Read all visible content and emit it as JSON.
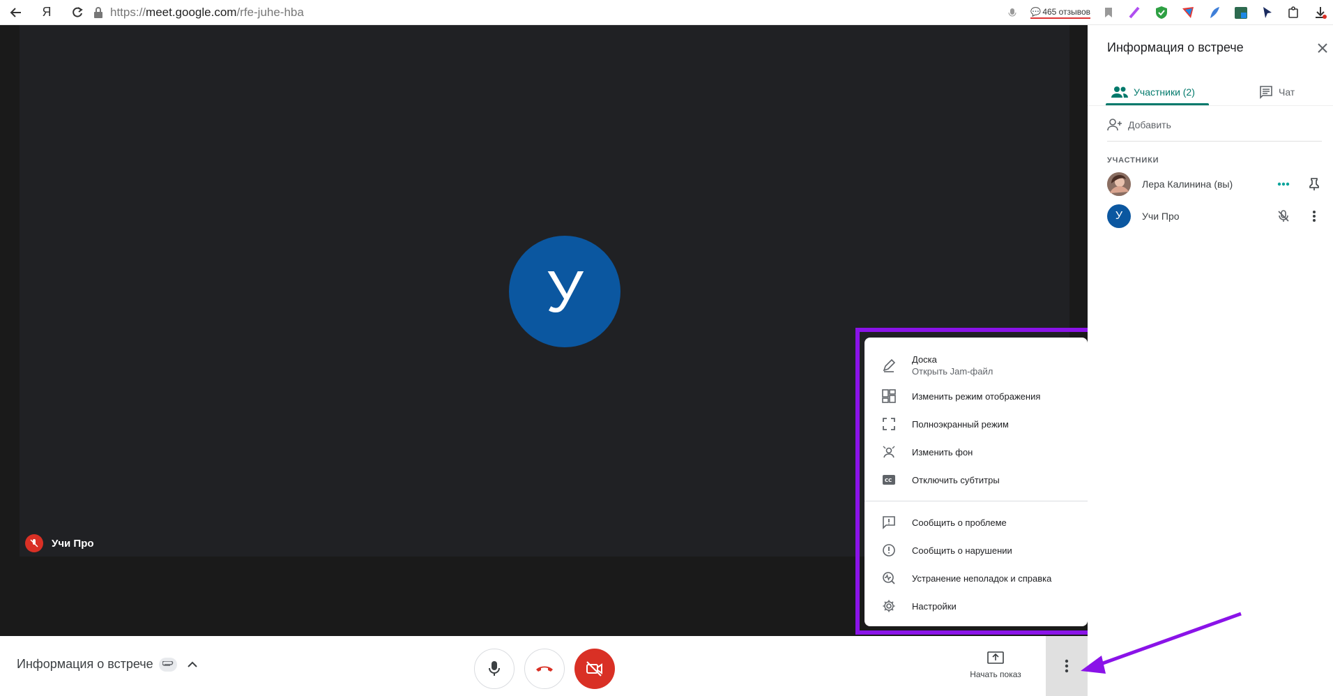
{
  "browser": {
    "url_protocol": "https://",
    "url_host": "meet.google.com",
    "url_path": "/rfe-juhe-hba",
    "yandex_label": "Я",
    "reviews_label": "465 отзывов"
  },
  "stage": {
    "avatar_letter": "У",
    "participant_name": "Учи Про"
  },
  "menu": {
    "items": [
      {
        "label": "Доска",
        "sub": "Открыть Jam-файл",
        "icon": "pen-icon"
      },
      {
        "label": "Изменить режим отображения",
        "icon": "layout-icon"
      },
      {
        "label": "Полноэкранный режим",
        "icon": "fullscreen-icon"
      },
      {
        "label": "Изменить фон",
        "icon": "background-icon"
      },
      {
        "label": "Отключить субтитры",
        "icon": "captions-icon"
      },
      {
        "label": "Сообщить о проблеме",
        "icon": "feedback-icon"
      },
      {
        "label": "Сообщить о нарушении",
        "icon": "report-icon"
      },
      {
        "label": "Устранение неполадок и справка",
        "icon": "troubleshoot-icon"
      },
      {
        "label": "Настройки",
        "icon": "settings-icon"
      }
    ]
  },
  "panel": {
    "title": "Информация о встрече",
    "tab_people": "Участники (2)",
    "tab_chat": "Чат",
    "add_label": "Добавить",
    "section_label": "УЧАСТНИКИ",
    "participants": [
      {
        "name": "Лера Калинина (вы)"
      },
      {
        "name": "Учи Про",
        "initial": "У"
      }
    ]
  },
  "bottombar": {
    "meeting_info": "Информация о встрече",
    "present_label": "Начать показ"
  },
  "colors": {
    "accent_teal": "#00796b",
    "danger_red": "#d93025",
    "avatar_blue": "#0b57a0",
    "highlight_purple": "#8a13e8",
    "stage_bg": "#202124"
  }
}
